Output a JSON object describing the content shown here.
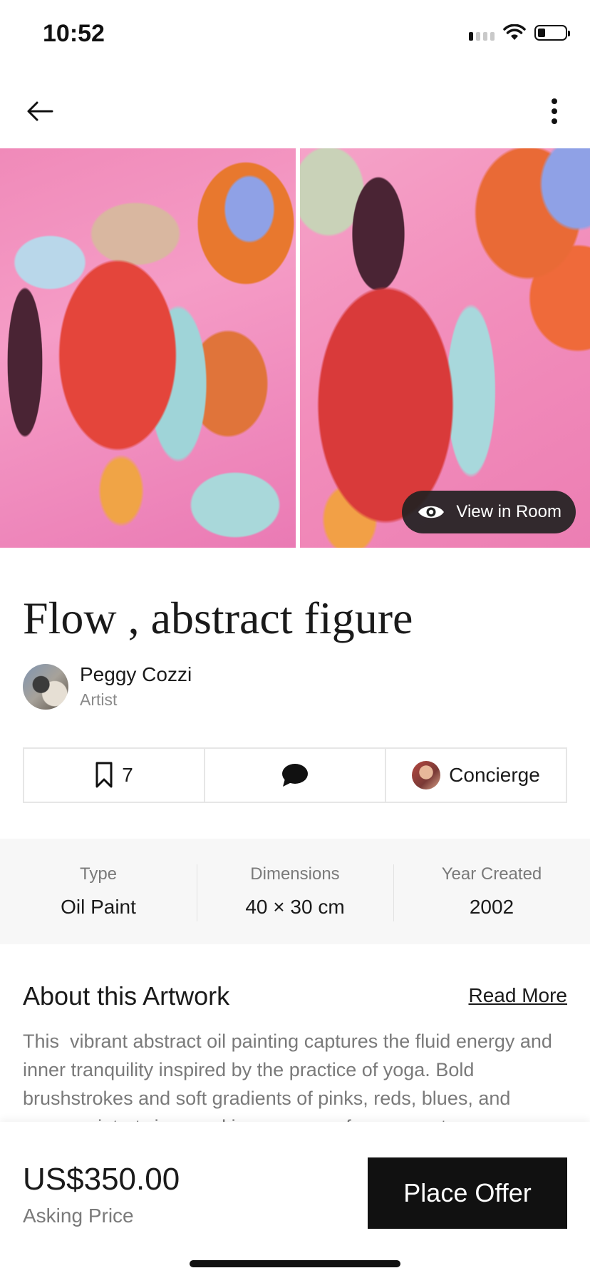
{
  "status_bar": {
    "time": "10:52"
  },
  "nav": {
    "back_icon": "arrow-left-icon",
    "more_icon": "more-vertical-icon"
  },
  "gallery": {
    "view_in_room_label": "View in Room",
    "view_icon": "eye-icon"
  },
  "artwork": {
    "title": "Flow , abstract figure"
  },
  "artist": {
    "name": "Peggy Cozzi",
    "role": "Artist"
  },
  "actions": {
    "save_count": "7",
    "concierge_label": "Concierge"
  },
  "specs": [
    {
      "label": "Type",
      "value": "Oil Paint"
    },
    {
      "label": "Dimensions",
      "value": "40 × 30 cm"
    },
    {
      "label": "Year Created",
      "value": "2002"
    }
  ],
  "about": {
    "title": "About this Artwork",
    "read_more": "Read More",
    "text": "This  vibrant abstract oil painting captures the fluid energy and inner tranquility inspired by the practice of yoga. Bold brushstrokes and soft gradients of pinks, reds, blues, and oranges intertwine, evoking a sense of movement"
  },
  "purchase": {
    "price": "US$350.00",
    "price_label": "Asking Price",
    "offer_button": "Place Offer"
  },
  "colors": {
    "primary_button": "#111111",
    "secondary_text": "#7a7a7a",
    "specs_background": "#f7f7f7"
  }
}
